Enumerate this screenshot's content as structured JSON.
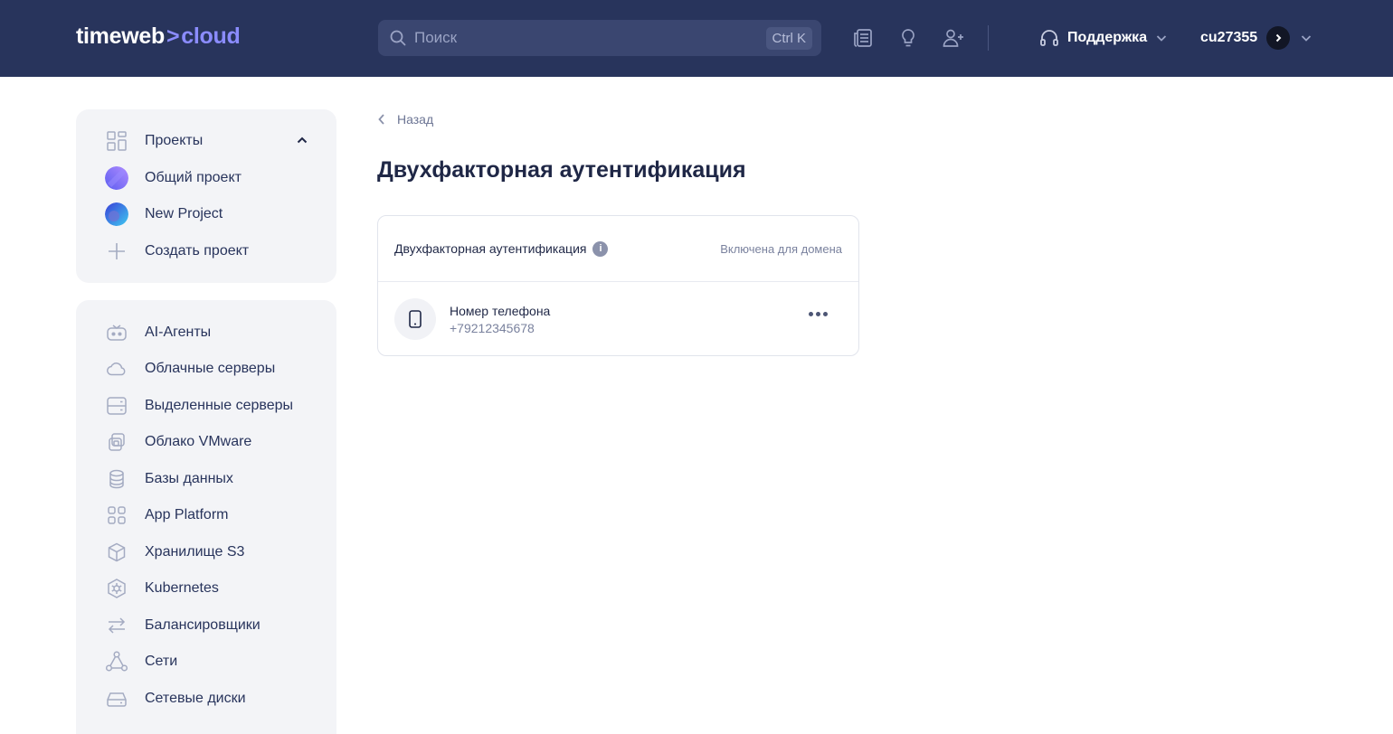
{
  "header": {
    "logo_left": "timeweb",
    "logo_sep": ">",
    "logo_right": "cloud",
    "search_placeholder": "Поиск",
    "search_shortcut": "Ctrl K",
    "support_label": "Поддержка",
    "username": "cu27355"
  },
  "sidebar": {
    "projects_label": "Проекты",
    "projects": [
      {
        "label": "Общий проект"
      },
      {
        "label": "New Project"
      },
      {
        "label": "Создать проект"
      }
    ],
    "services": [
      {
        "label": "AI-Агенты",
        "icon": "robot-icon"
      },
      {
        "label": "Облачные серверы",
        "icon": "cloud-icon"
      },
      {
        "label": "Выделенные серверы",
        "icon": "server-icon"
      },
      {
        "label": "Облако VMware",
        "icon": "vmware-icon"
      },
      {
        "label": "Базы данных",
        "icon": "database-icon"
      },
      {
        "label": "App Platform",
        "icon": "apps-grid-icon"
      },
      {
        "label": "Хранилище S3",
        "icon": "box-icon"
      },
      {
        "label": "Kubernetes",
        "icon": "kubernetes-icon"
      },
      {
        "label": "Балансировщики",
        "icon": "balancer-arrows-icon"
      },
      {
        "label": "Сети",
        "icon": "network-icon"
      },
      {
        "label": "Сетевые диски",
        "icon": "disk-icon"
      }
    ]
  },
  "main": {
    "back_label": "Назад",
    "title": "Двухфакторная аутентификация",
    "card": {
      "heading": "Двухфакторная аутентификация",
      "status": "Включена для домена",
      "method_title": "Номер телефона",
      "method_value": "+79212345678"
    }
  },
  "colors": {
    "header_bg": "#28345c",
    "accent": "#8b8cff",
    "sidebar_bg": "#f3f4f7"
  }
}
